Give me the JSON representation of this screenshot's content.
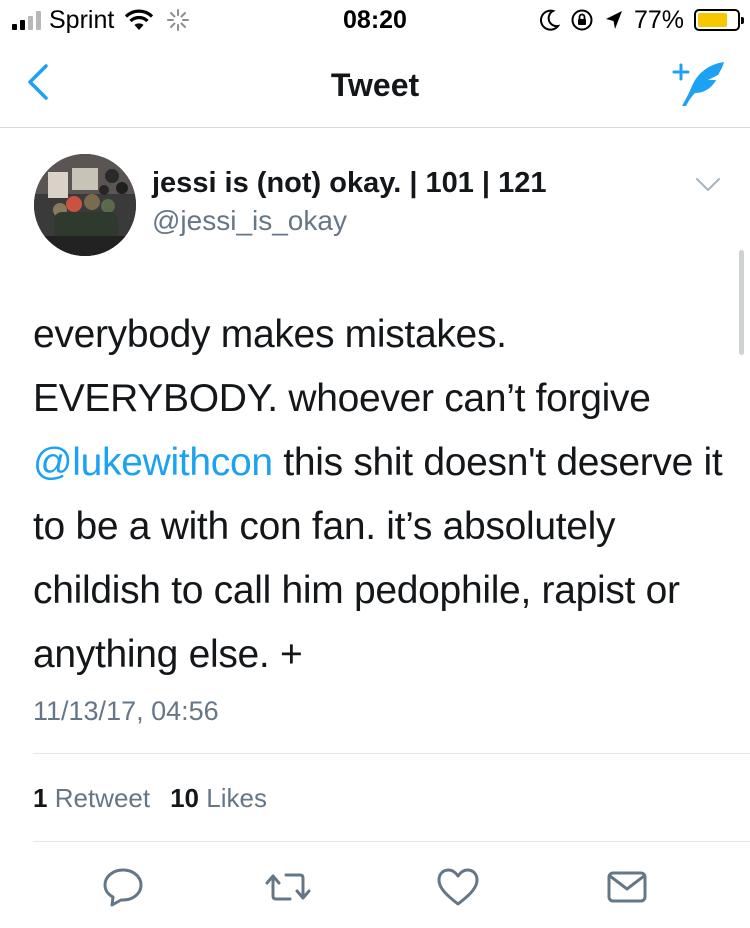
{
  "status_bar": {
    "carrier": "Sprint",
    "time": "08:20",
    "battery_percent": "77%",
    "battery_level": 0.77,
    "battery_color": "#f7c800"
  },
  "nav": {
    "back_icon": "chevron-left-icon",
    "title": "Tweet",
    "compose_icon": "compose-tweet-icon",
    "accent_color": "#1da1f2"
  },
  "tweet": {
    "author_name": "jessi is (not) okay. | 101 | 121",
    "author_handle": "@jessi_is_okay",
    "text_before_mention": "everybody makes mistakes. EVERYBODY. whoever can’t forgive ",
    "mention": "@lukewithcon",
    "text_after_mention": " this shit doesn't deserve it to be a with con fan. it’s absolutely childish to call him pedophile, rapist or anything else. +",
    "timestamp": "11/13/17, 04:56",
    "retweet_count": "1",
    "retweet_label": "Retweet",
    "like_count": "10",
    "like_label": "Likes"
  },
  "actions": [
    {
      "icon": "reply-icon"
    },
    {
      "icon": "retweet-icon"
    },
    {
      "icon": "like-icon"
    },
    {
      "icon": "direct-message-icon"
    }
  ]
}
